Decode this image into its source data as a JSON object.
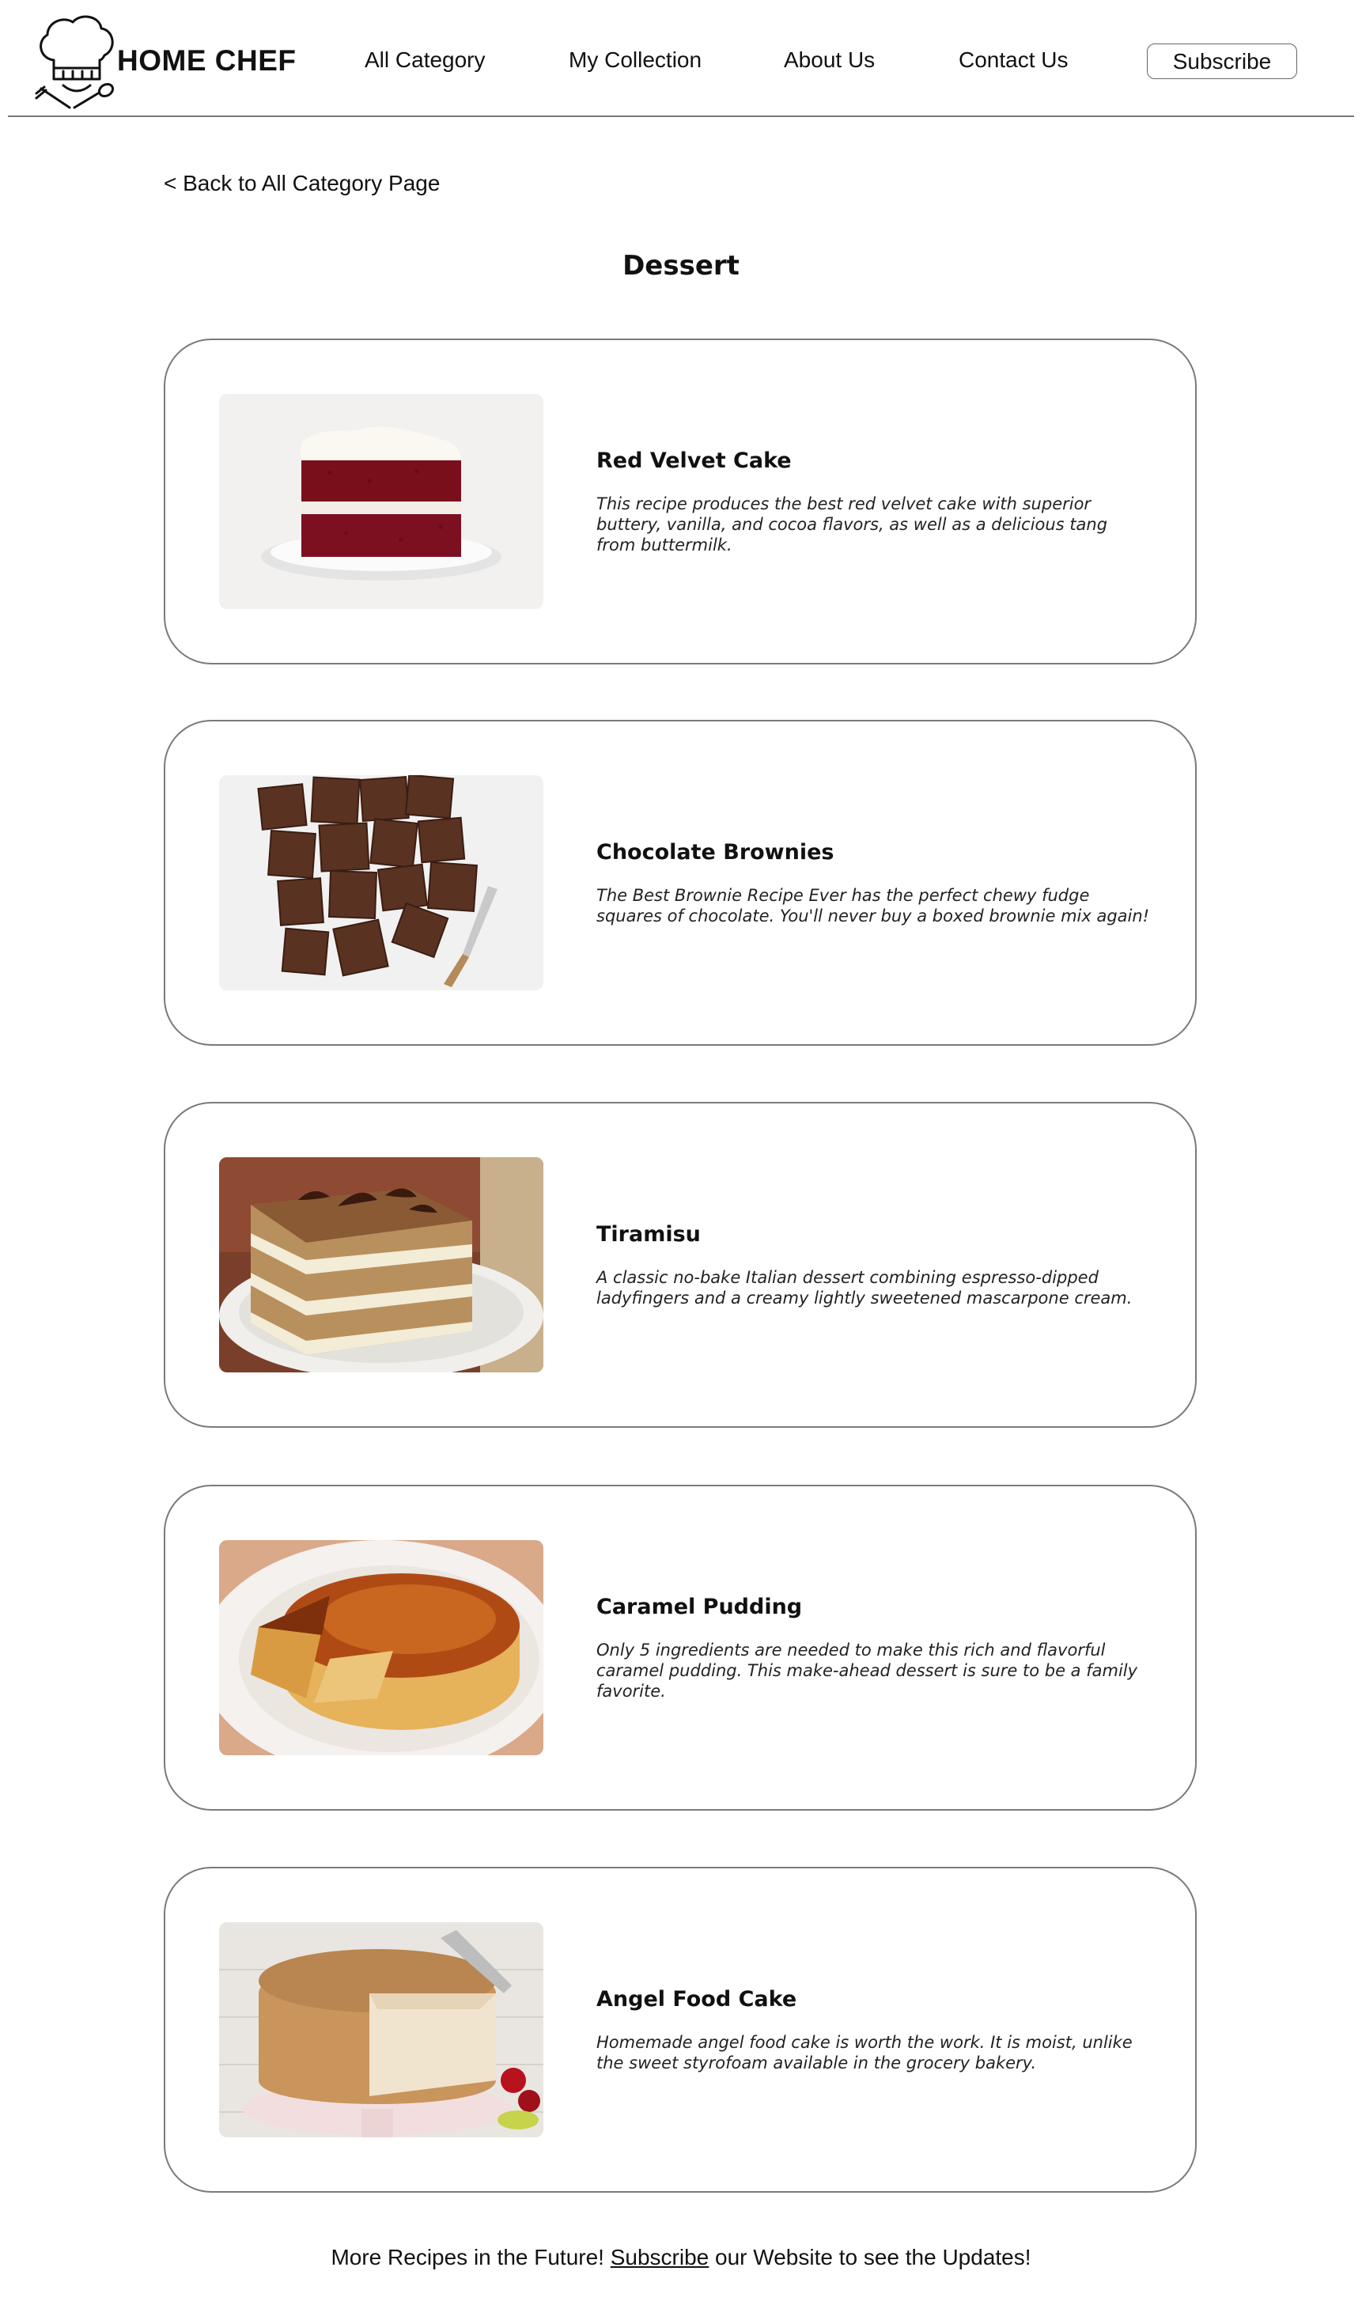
{
  "header": {
    "brand": "HOME CHEF",
    "logo_icon": "chef-hat-icon",
    "nav": [
      {
        "label": "All Category"
      },
      {
        "label": "My Collection"
      },
      {
        "label": "About Us"
      },
      {
        "label": "Contact Us"
      }
    ],
    "subscribe_label": "Subscribe"
  },
  "back_link": "< Back to All Category Page",
  "page_title": "Dessert",
  "recipes": [
    {
      "title": "Red Velvet Cake",
      "description": "This recipe produces the best red velvet cake with superior buttery, vanilla, and cocoa flavors, as well as a delicious tang from buttermilk."
    },
    {
      "title": "Chocolate Brownies",
      "description": "The Best Brownie Recipe Ever has the perfect chewy fudge squares of chocolate. You'll never buy a boxed brownie mix again!"
    },
    {
      "title": "Tiramisu",
      "description": "A classic no-bake Italian dessert combining espresso-dipped ladyfingers and a creamy lightly sweetened mascarpone cream."
    },
    {
      "title": "Caramel Pudding",
      "description": "Only 5 ingredients are needed to make this rich and flavorful caramel pudding. This make-ahead dessert is sure to be a family favorite."
    },
    {
      "title": "Angel Food Cake",
      "description": "Homemade angel food cake is worth the work. It is moist, unlike the sweet styrofoam available in the grocery bakery."
    }
  ],
  "footer": {
    "before": "More Recipes in the Future! ",
    "link": "Subscribe",
    "after": " our Website to see the Updates!"
  }
}
